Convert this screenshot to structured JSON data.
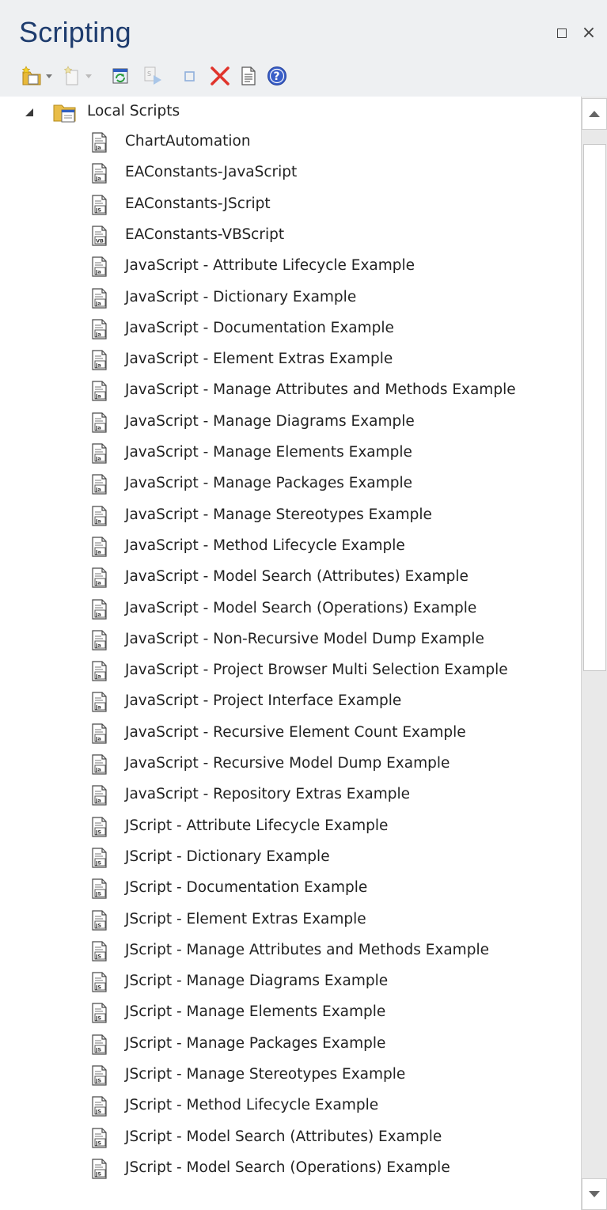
{
  "window": {
    "title": "Scripting"
  },
  "toolbar": {
    "tools": [
      {
        "icon": "new-script-group-icon",
        "has_dropdown": true,
        "enabled": true
      },
      {
        "icon": "new-script-icon",
        "has_dropdown": true,
        "enabled": false
      },
      {
        "icon": "refresh-icon",
        "has_dropdown": false,
        "enabled": true
      },
      {
        "icon": "run-script-icon",
        "has_dropdown": false,
        "enabled": false
      },
      {
        "icon": "stop-script-icon",
        "has_dropdown": false,
        "enabled": false
      },
      {
        "icon": "delete-icon",
        "has_dropdown": false,
        "enabled": true
      },
      {
        "icon": "properties-icon",
        "has_dropdown": false,
        "enabled": true
      },
      {
        "icon": "help-icon",
        "has_dropdown": false,
        "enabled": true
      }
    ]
  },
  "tree": {
    "root": {
      "label": "Local Scripts",
      "expanded": true,
      "icon": "script-folder-icon"
    },
    "items": [
      {
        "label": "ChartAutomation",
        "lang": "Ja"
      },
      {
        "label": "EAConstants-JavaScript",
        "lang": "Ja"
      },
      {
        "label": "EAConstants-JScript",
        "lang": "JS"
      },
      {
        "label": "EAConstants-VBScript",
        "lang": "VB"
      },
      {
        "label": "JavaScript - Attribute Lifecycle Example",
        "lang": "Ja"
      },
      {
        "label": "JavaScript - Dictionary Example",
        "lang": "Ja"
      },
      {
        "label": "JavaScript - Documentation Example",
        "lang": "Ja"
      },
      {
        "label": "JavaScript - Element Extras Example",
        "lang": "Ja"
      },
      {
        "label": "JavaScript - Manage Attributes and Methods Example",
        "lang": "Ja"
      },
      {
        "label": "JavaScript - Manage Diagrams Example",
        "lang": "Ja"
      },
      {
        "label": "JavaScript - Manage Elements Example",
        "lang": "Ja"
      },
      {
        "label": "JavaScript - Manage Packages Example",
        "lang": "Ja"
      },
      {
        "label": "JavaScript - Manage Stereotypes Example",
        "lang": "Ja"
      },
      {
        "label": "JavaScript - Method Lifecycle Example",
        "lang": "Ja"
      },
      {
        "label": "JavaScript - Model Search (Attributes) Example",
        "lang": "Ja"
      },
      {
        "label": "JavaScript - Model Search (Operations) Example",
        "lang": "Ja"
      },
      {
        "label": "JavaScript - Non-Recursive Model Dump Example",
        "lang": "Ja"
      },
      {
        "label": "JavaScript - Project Browser Multi Selection Example",
        "lang": "Ja"
      },
      {
        "label": "JavaScript - Project Interface Example",
        "lang": "Ja"
      },
      {
        "label": "JavaScript - Recursive Element Count Example",
        "lang": "Ja"
      },
      {
        "label": "JavaScript - Recursive Model Dump Example",
        "lang": "Ja"
      },
      {
        "label": "JavaScript - Repository Extras Example",
        "lang": "Ja"
      },
      {
        "label": "JScript - Attribute Lifecycle Example",
        "lang": "JS"
      },
      {
        "label": "JScript - Dictionary Example",
        "lang": "JS"
      },
      {
        "label": "JScript - Documentation Example",
        "lang": "JS"
      },
      {
        "label": "JScript - Element Extras Example",
        "lang": "JS"
      },
      {
        "label": "JScript - Manage Attributes and Methods Example",
        "lang": "JS"
      },
      {
        "label": "JScript - Manage Diagrams Example",
        "lang": "JS"
      },
      {
        "label": "JScript - Manage Elements Example",
        "lang": "JS"
      },
      {
        "label": "JScript - Manage Packages Example",
        "lang": "JS"
      },
      {
        "label": "JScript - Manage Stereotypes Example",
        "lang": "JS"
      },
      {
        "label": "JScript - Method Lifecycle Example",
        "lang": "JS"
      },
      {
        "label": "JScript - Model Search (Attributes) Example",
        "lang": "JS"
      },
      {
        "label": "JScript - Model Search (Operations) Example",
        "lang": "JS"
      }
    ]
  },
  "colors": {
    "title": "#1e3c6e",
    "panel_bg": "#eef0f2",
    "delete_red": "#e0342c",
    "help_blue": "#3a5fc8"
  }
}
